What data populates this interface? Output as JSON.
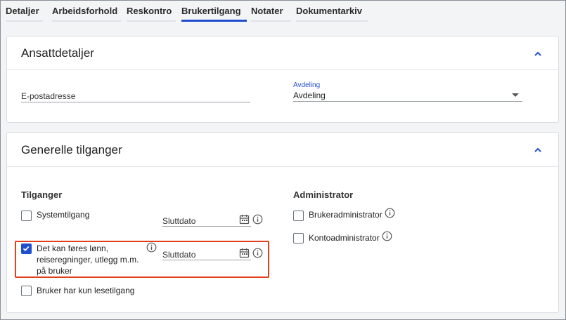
{
  "tabs": [
    {
      "label": "Detaljer"
    },
    {
      "label": "Arbeidsforhold"
    },
    {
      "label": "Reskontro"
    },
    {
      "label": "Brukertilgang"
    },
    {
      "label": "Notater"
    },
    {
      "label": "Dokumentarkiv"
    }
  ],
  "active_tab": "Brukertilgang",
  "ansattdetaljer": {
    "title": "Ansattdetaljer",
    "email_placeholder": "E-postadresse",
    "department_label": "Avdeling",
    "department_value": "Avdeling"
  },
  "generelle": {
    "title": "Generelle tilganger",
    "tilganger_title": "Tilganger",
    "administrator_title": "Administrator",
    "systemtilgang": {
      "label": "Systemtilgang",
      "checked": false,
      "end_date_placeholder": "Sluttdato"
    },
    "foring": {
      "line1": "Det kan føres lønn,",
      "line2": "reiseregninger, utlegg m.m.",
      "line3": "på bruker",
      "checked": true,
      "end_date_placeholder": "Sluttdato"
    },
    "lesetilgang": {
      "label": "Bruker har kun lesetilgang",
      "checked": false
    },
    "brukeradmin": {
      "label": "Brukeradministrator",
      "checked": false
    },
    "kontoadmin": {
      "label": "Kontoadministrator",
      "checked": false
    }
  },
  "colors": {
    "accent": "#1f4fcf",
    "highlight": "#e0401c"
  }
}
